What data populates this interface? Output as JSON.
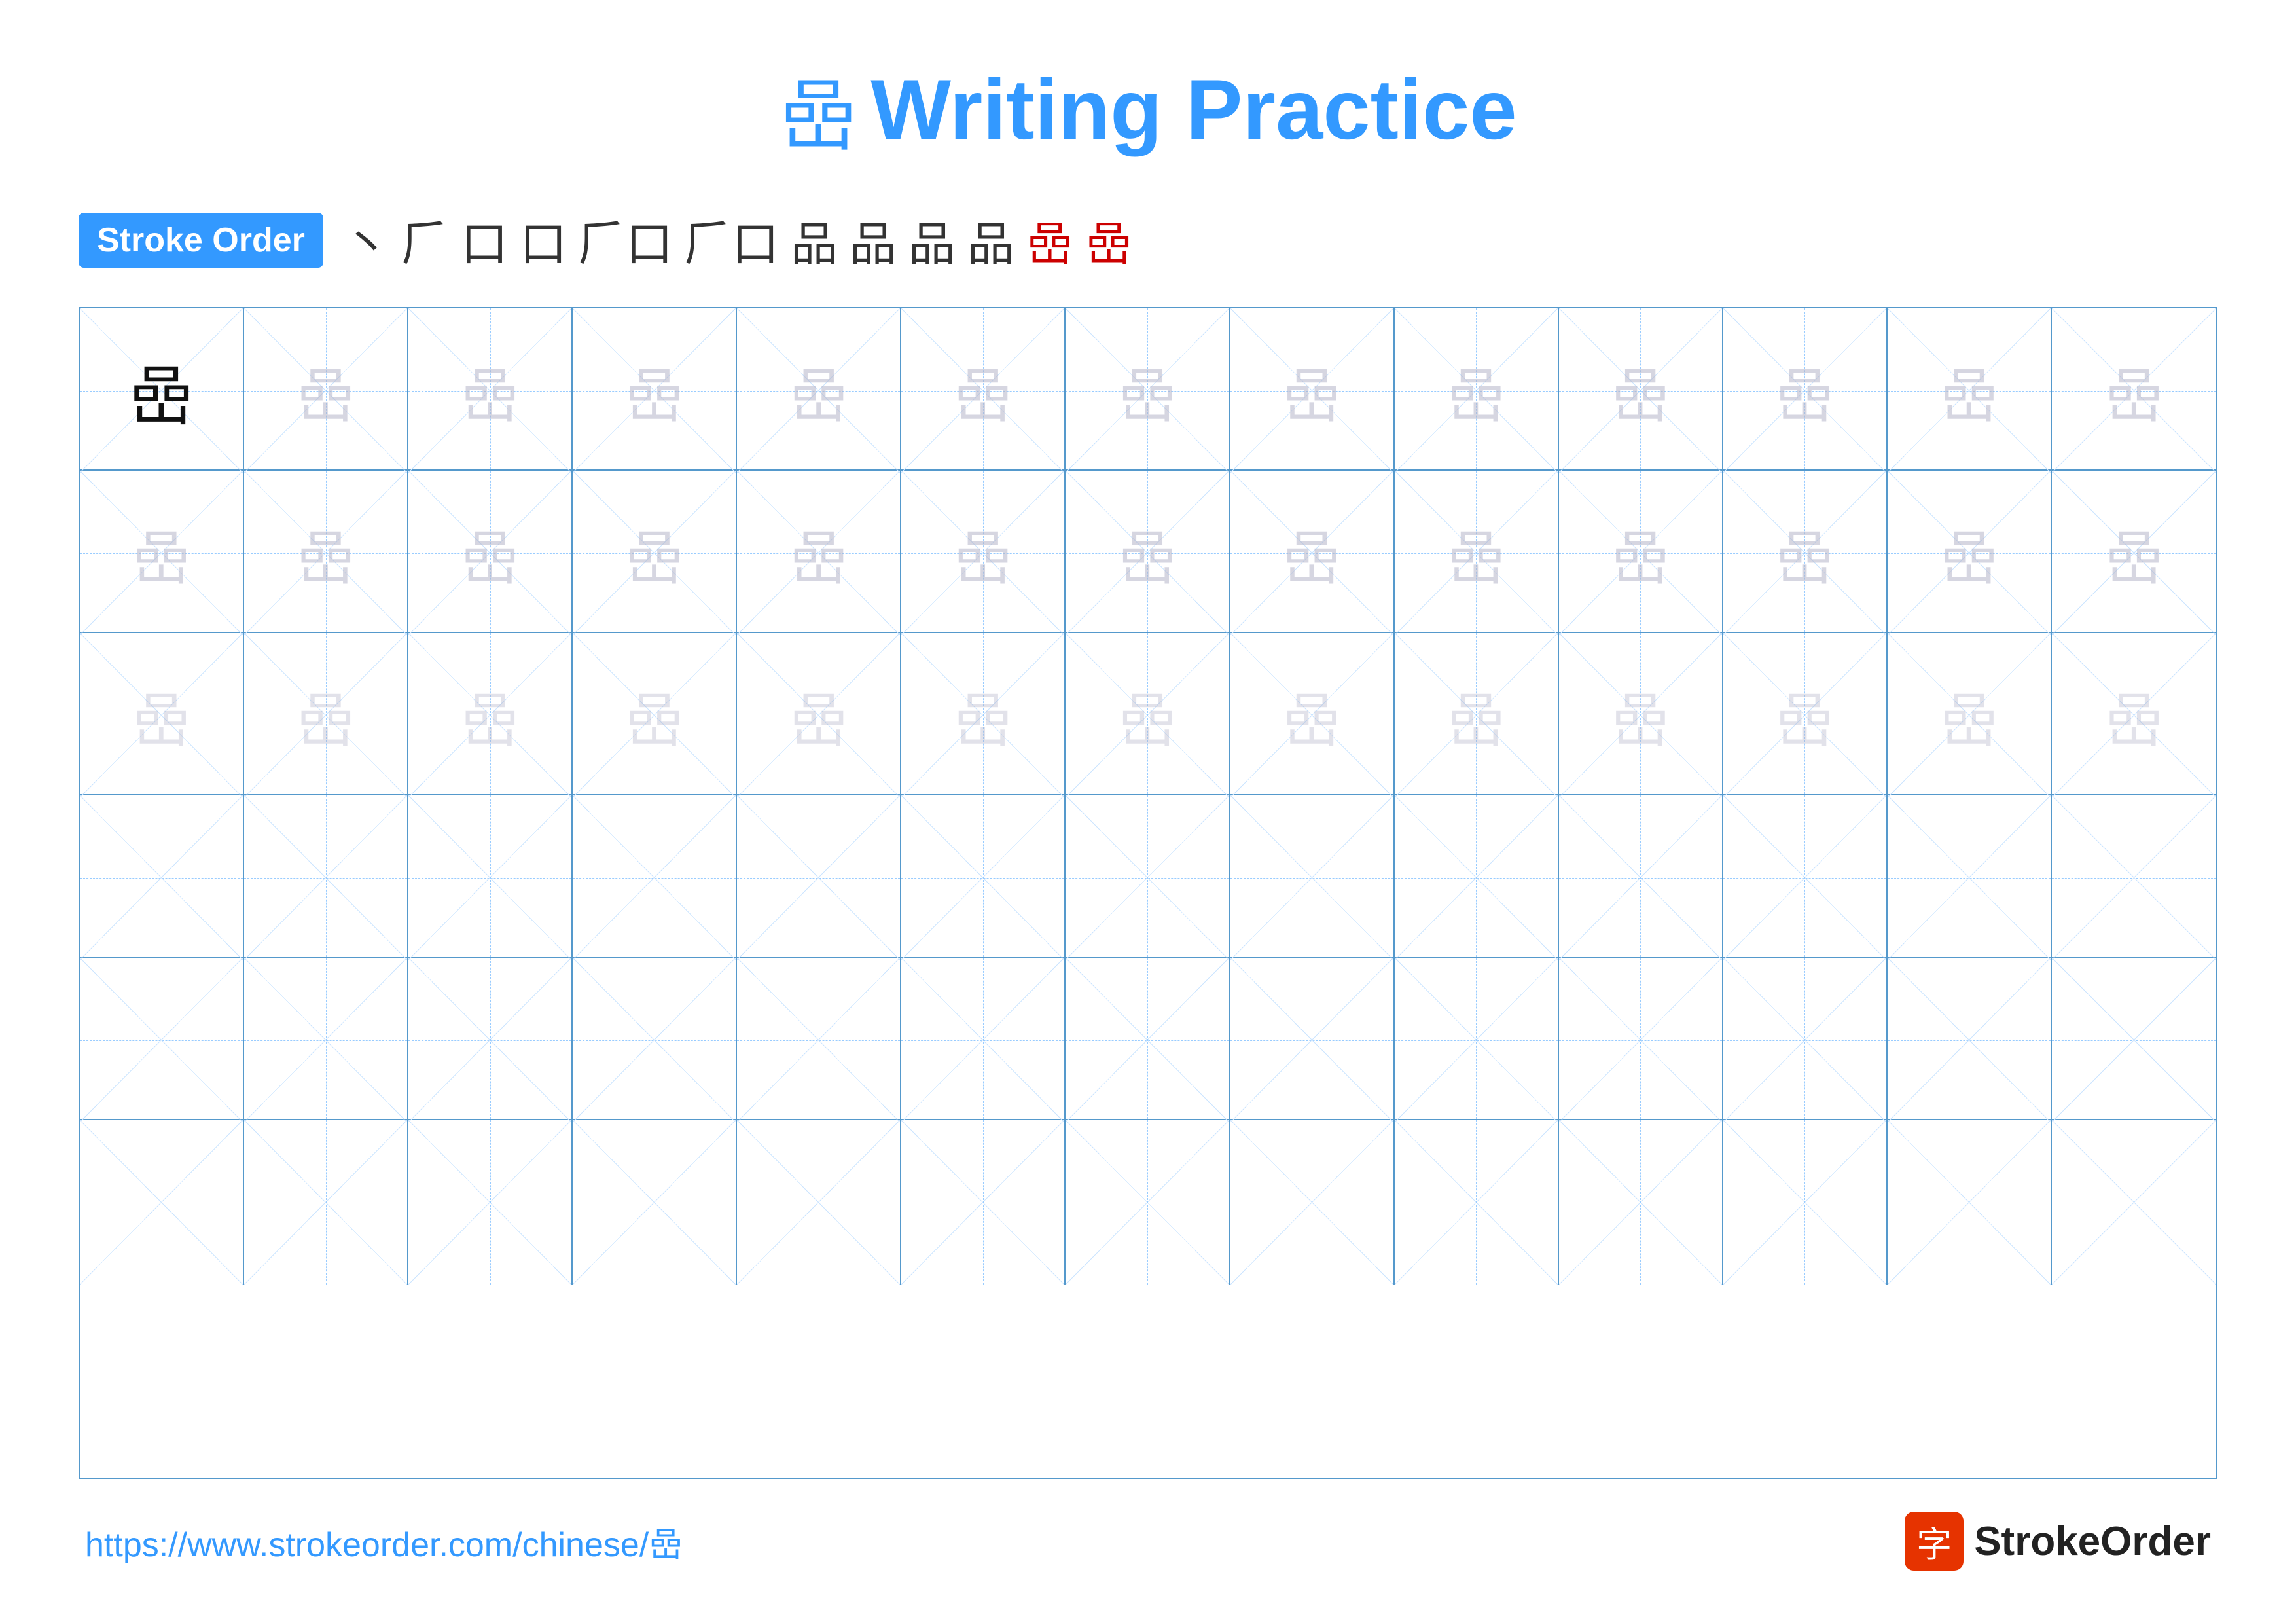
{
  "page": {
    "title_char": "嵒",
    "title_text": "Writing Practice",
    "stroke_order_label": "Stroke Order",
    "stroke_steps": [
      "丶",
      "𠂆",
      "口",
      "丨口",
      "𠂆口",
      "𠂆口",
      "品",
      "品",
      "品",
      "品",
      "嵒",
      "嵒"
    ],
    "char": "嵒",
    "footer_url": "https://www.strokeorder.com/chinese/嵒",
    "footer_logo_icon": "字",
    "footer_logo_text": "StrokeOrder",
    "rows": 6,
    "cols": 13
  }
}
